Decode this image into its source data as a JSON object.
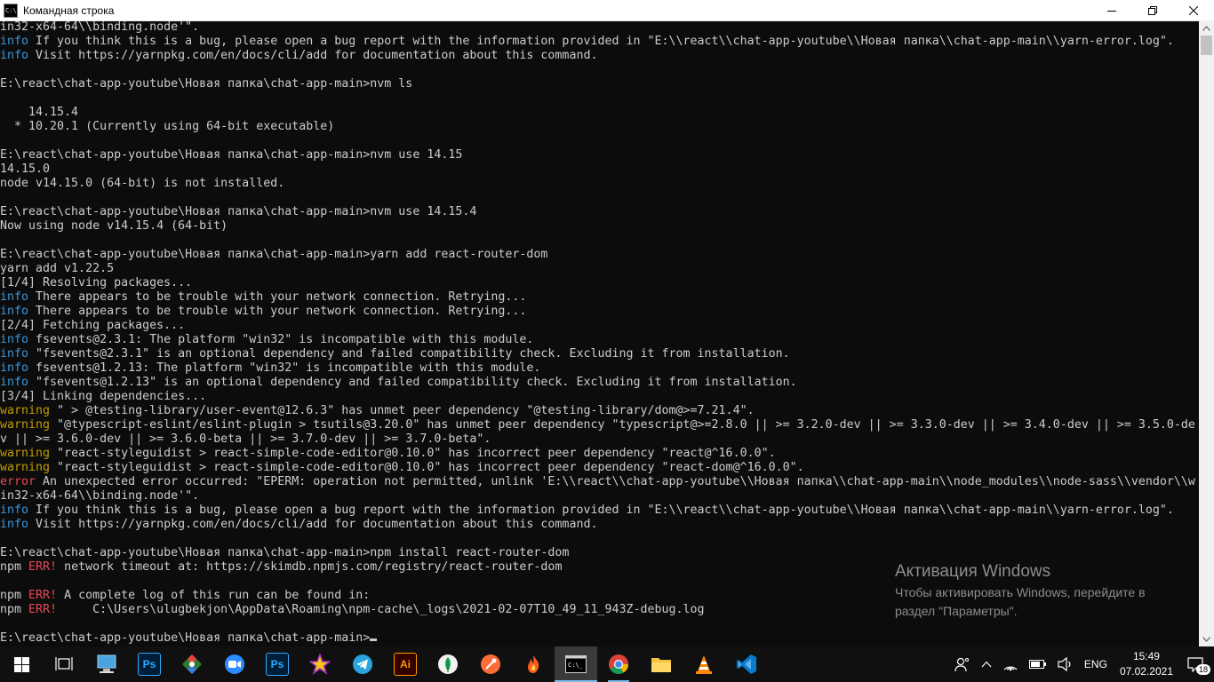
{
  "window": {
    "title": "Командная строка"
  },
  "console_lines": [
    [
      {
        "text": "in32-x64-64\\\\binding.node'\"."
      }
    ],
    [
      {
        "tag": "info",
        "text": "info"
      },
      {
        "text": " If you think this is a bug, please open a bug report with the information provided in \"E:\\\\react\\\\chat-app-youtube\\\\Новая папка\\\\chat-app-main\\\\yarn-error.log\"."
      }
    ],
    [
      {
        "tag": "info",
        "text": "info"
      },
      {
        "text": " Visit https://yarnpkg.com/en/docs/cli/add for documentation about this command."
      }
    ],
    [
      {
        "text": ""
      }
    ],
    [
      {
        "text": "E:\\react\\chat-app-youtube\\Новая папка\\chat-app-main>nvm ls"
      }
    ],
    [
      {
        "text": ""
      }
    ],
    [
      {
        "text": "    14.15.4"
      }
    ],
    [
      {
        "text": "  * 10.20.1 (Currently using 64-bit executable)"
      }
    ],
    [
      {
        "text": ""
      }
    ],
    [
      {
        "text": "E:\\react\\chat-app-youtube\\Новая папка\\chat-app-main>nvm use 14.15"
      }
    ],
    [
      {
        "text": "14.15.0"
      }
    ],
    [
      {
        "text": "node v14.15.0 (64-bit) is not installed."
      }
    ],
    [
      {
        "text": ""
      }
    ],
    [
      {
        "text": "E:\\react\\chat-app-youtube\\Новая папка\\chat-app-main>nvm use 14.15.4"
      }
    ],
    [
      {
        "text": "Now using node v14.15.4 (64-bit)"
      }
    ],
    [
      {
        "text": ""
      }
    ],
    [
      {
        "text": "E:\\react\\chat-app-youtube\\Новая папка\\chat-app-main>yarn add react-router-dom"
      }
    ],
    [
      {
        "text": "yarn add v1.22.5"
      }
    ],
    [
      {
        "text": "[1/4] Resolving packages..."
      }
    ],
    [
      {
        "tag": "info",
        "text": "info"
      },
      {
        "text": " There appears to be trouble with your network connection. Retrying..."
      }
    ],
    [
      {
        "tag": "info",
        "text": "info"
      },
      {
        "text": " There appears to be trouble with your network connection. Retrying..."
      }
    ],
    [
      {
        "text": "[2/4] Fetching packages..."
      }
    ],
    [
      {
        "tag": "info",
        "text": "info"
      },
      {
        "text": " fsevents@2.3.1: The platform \"win32\" is incompatible with this module."
      }
    ],
    [
      {
        "tag": "info",
        "text": "info"
      },
      {
        "text": " \"fsevents@2.3.1\" is an optional dependency and failed compatibility check. Excluding it from installation."
      }
    ],
    [
      {
        "tag": "info",
        "text": "info"
      },
      {
        "text": " fsevents@1.2.13: The platform \"win32\" is incompatible with this module."
      }
    ],
    [
      {
        "tag": "info",
        "text": "info"
      },
      {
        "text": " \"fsevents@1.2.13\" is an optional dependency and failed compatibility check. Excluding it from installation."
      }
    ],
    [
      {
        "text": "[3/4] Linking dependencies..."
      }
    ],
    [
      {
        "tag": "warning",
        "text": "warning"
      },
      {
        "text": " \" > @testing-library/user-event@12.6.3\" has unmet peer dependency \"@testing-library/dom@>=7.21.4\"."
      }
    ],
    [
      {
        "tag": "warning",
        "text": "warning"
      },
      {
        "text": " \"@typescript-eslint/eslint-plugin > tsutils@3.20.0\" has unmet peer dependency \"typescript@>=2.8.0 || >= 3.2.0-dev || >= 3.3.0-dev || >= 3.4.0-dev || >= 3.5.0-de"
      }
    ],
    [
      {
        "text": "v || >= 3.6.0-dev || >= 3.6.0-beta || >= 3.7.0-dev || >= 3.7.0-beta\"."
      }
    ],
    [
      {
        "tag": "warning",
        "text": "warning"
      },
      {
        "text": " \"react-styleguidist > react-simple-code-editor@0.10.0\" has incorrect peer dependency \"react@^16.0.0\"."
      }
    ],
    [
      {
        "tag": "warning",
        "text": "warning"
      },
      {
        "text": " \"react-styleguidist > react-simple-code-editor@0.10.0\" has incorrect peer dependency \"react-dom@^16.0.0\"."
      }
    ],
    [
      {
        "tag": "error",
        "text": "error"
      },
      {
        "text": " An unexpected error occurred: \"EPERM: operation not permitted, unlink 'E:\\\\react\\\\chat-app-youtube\\\\Новая папка\\\\chat-app-main\\\\node_modules\\\\node-sass\\\\vendor\\\\w"
      }
    ],
    [
      {
        "text": "in32-x64-64\\\\binding.node'\"."
      }
    ],
    [
      {
        "tag": "info",
        "text": "info"
      },
      {
        "text": " If you think this is a bug, please open a bug report with the information provided in \"E:\\\\react\\\\chat-app-youtube\\\\Новая папка\\\\chat-app-main\\\\yarn-error.log\"."
      }
    ],
    [
      {
        "tag": "info",
        "text": "info"
      },
      {
        "text": " Visit https://yarnpkg.com/en/docs/cli/add for documentation about this command."
      }
    ],
    [
      {
        "text": ""
      }
    ],
    [
      {
        "text": "E:\\react\\chat-app-youtube\\Новая папка\\chat-app-main>npm install react-router-dom"
      }
    ],
    [
      {
        "text": "npm "
      },
      {
        "tag": "error",
        "text": "ERR!"
      },
      {
        "text": " network timeout at: https://skimdb.npmjs.com/registry/react-router-dom"
      }
    ],
    [
      {
        "text": ""
      }
    ],
    [
      {
        "text": "npm "
      },
      {
        "tag": "error",
        "text": "ERR!"
      },
      {
        "text": " A complete log of this run can be found in:"
      }
    ],
    [
      {
        "text": "npm "
      },
      {
        "tag": "error",
        "text": "ERR!"
      },
      {
        "text": "     C:\\Users\\ulugbekjon\\AppData\\Roaming\\npm-cache\\_logs\\2021-02-07T10_49_11_943Z-debug.log"
      }
    ],
    [
      {
        "text": ""
      }
    ],
    [
      {
        "text": "E:\\react\\chat-app-youtube\\Новая папка\\chat-app-main>"
      },
      {
        "cursor": true
      }
    ]
  ],
  "tag_colors": {
    "info": "#3a96dd",
    "warning": "#c19c00",
    "error": "#e74856"
  },
  "activation": {
    "title": "Активация Windows",
    "text": "Чтобы активировать Windows, перейдите в раздел \"Параметры\"."
  },
  "taskbar": {
    "apps": [
      {
        "name": "start-button",
        "icon": "windows-logo-icon"
      },
      {
        "name": "task-view-button",
        "icon": "task-view-icon"
      },
      {
        "name": "taskbar-app-this-pc",
        "icon": "computer-icon"
      },
      {
        "name": "taskbar-app-photoshop",
        "icon": "photoshop-icon",
        "label": "Ps"
      },
      {
        "name": "taskbar-app-sourcetree",
        "icon": "diamond-icon"
      },
      {
        "name": "taskbar-app-zoom",
        "icon": "zoom-camera-icon"
      },
      {
        "name": "taskbar-app-photoshop-2",
        "icon": "photoshop-icon",
        "label": "Ps"
      },
      {
        "name": "taskbar-app-star",
        "icon": "star-icon"
      },
      {
        "name": "taskbar-app-telegram",
        "icon": "telegram-icon"
      },
      {
        "name": "taskbar-app-illustrator",
        "icon": "illustrator-icon",
        "label": "Ai"
      },
      {
        "name": "taskbar-app-mongodb",
        "icon": "leaf-icon"
      },
      {
        "name": "taskbar-app-postman",
        "icon": "postman-icon"
      },
      {
        "name": "taskbar-app-flame",
        "icon": "flame-icon"
      },
      {
        "name": "taskbar-app-cmd",
        "icon": "cmd-icon",
        "active": true
      },
      {
        "name": "taskbar-app-chrome",
        "icon": "chrome-icon",
        "running": true
      },
      {
        "name": "taskbar-app-explorer",
        "icon": "folder-icon"
      },
      {
        "name": "taskbar-app-vlc",
        "icon": "vlc-cone-icon"
      },
      {
        "name": "taskbar-app-vscode",
        "icon": "vscode-icon"
      }
    ],
    "tray": {
      "language": "ENG",
      "time": "15:49",
      "date": "07.02.2021",
      "notifications_count": "18"
    }
  }
}
